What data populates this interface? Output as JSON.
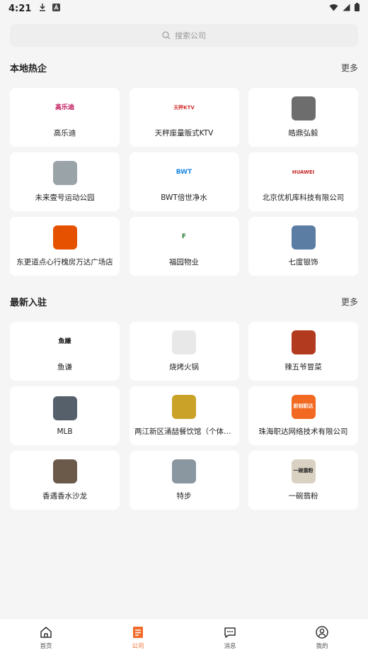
{
  "status_bar": {
    "time": "4:21"
  },
  "search": {
    "placeholder": "搜索公司"
  },
  "section_local": {
    "title": "本地热企",
    "more": "更多",
    "items": [
      {
        "label": "高乐迪",
        "thumb_text": "高乐迪",
        "thumb_bg": "#ffffff",
        "thumb_fg": "#c2185b"
      },
      {
        "label": "天秤座量贩式KTV",
        "thumb_text": "天秤KTV",
        "thumb_bg": "#ffffff",
        "thumb_fg": "#d32f2f"
      },
      {
        "label": "皓鼎弘毅",
        "thumb_text": "",
        "thumb_bg": "#6d6d6d",
        "thumb_fg": "#e53935"
      },
      {
        "label": "未来壹号运动公园",
        "thumb_text": "",
        "thumb_bg": "#9aa3a8",
        "thumb_fg": "#ffffff"
      },
      {
        "label": "BWT倍世净水",
        "thumb_text": "BWT",
        "thumb_bg": "#ffffff",
        "thumb_fg": "#1e88e5"
      },
      {
        "label": "北京优机库科技有限公司",
        "thumb_text": "HUAWEI",
        "thumb_bg": "#ffffff",
        "thumb_fg": "#c62828"
      },
      {
        "label": "东更道点心行槐房万达广场店",
        "thumb_text": "",
        "thumb_bg": "#e65100",
        "thumb_fg": "#ffffff"
      },
      {
        "label": "福园物业",
        "thumb_text": "F",
        "thumb_bg": "#ffffff",
        "thumb_fg": "#2e7d32"
      },
      {
        "label": "七度银饰",
        "thumb_text": "",
        "thumb_bg": "#5c7da3",
        "thumb_fg": "#ffffff"
      }
    ]
  },
  "section_new": {
    "title": "最新入驻",
    "more": "更多",
    "items": [
      {
        "label": "鱼谦",
        "thumb_text": "魚謙",
        "thumb_bg": "#ffffff",
        "thumb_fg": "#111111"
      },
      {
        "label": "烧烤火锅",
        "thumb_text": "",
        "thumb_bg": "#e8e8e8",
        "thumb_fg": "#999999"
      },
      {
        "label": "辣五爷冒菜",
        "thumb_text": "",
        "thumb_bg": "#b23a1e",
        "thumb_fg": "#ffcc00"
      },
      {
        "label": "MLB",
        "thumb_text": "",
        "thumb_bg": "#55606a",
        "thumb_fg": "#ffffff"
      },
      {
        "label": "两江新区涌喆餐饮馆（个体工商户）",
        "thumb_text": "",
        "thumb_bg": "#c9a227",
        "thumb_fg": "#7a3b10"
      },
      {
        "label": "珠海职达网络技术有限公司",
        "thumb_text": "即刻职达",
        "thumb_bg": "#f26a21",
        "thumb_fg": "#ffffff"
      },
      {
        "label": "香遇香水沙龙",
        "thumb_text": "",
        "thumb_bg": "#6b5a4a",
        "thumb_fg": "#ffffff"
      },
      {
        "label": "特步",
        "thumb_text": "",
        "thumb_bg": "#8a96a0",
        "thumb_fg": "#ffffff"
      },
      {
        "label": "一碗翡粉",
        "thumb_text": "一碗翡粉",
        "thumb_bg": "#d9d2c2",
        "thumb_fg": "#222222"
      }
    ]
  },
  "tabs": [
    {
      "label": "首页",
      "icon": "home-icon",
      "active": false
    },
    {
      "label": "公司",
      "icon": "company-icon",
      "active": true
    },
    {
      "label": "消息",
      "icon": "message-icon",
      "active": false
    },
    {
      "label": "我的",
      "icon": "profile-icon",
      "active": false
    }
  ],
  "colors": {
    "accent": "#f06a2c",
    "background": "#f5f5f5",
    "card": "#ffffff"
  }
}
